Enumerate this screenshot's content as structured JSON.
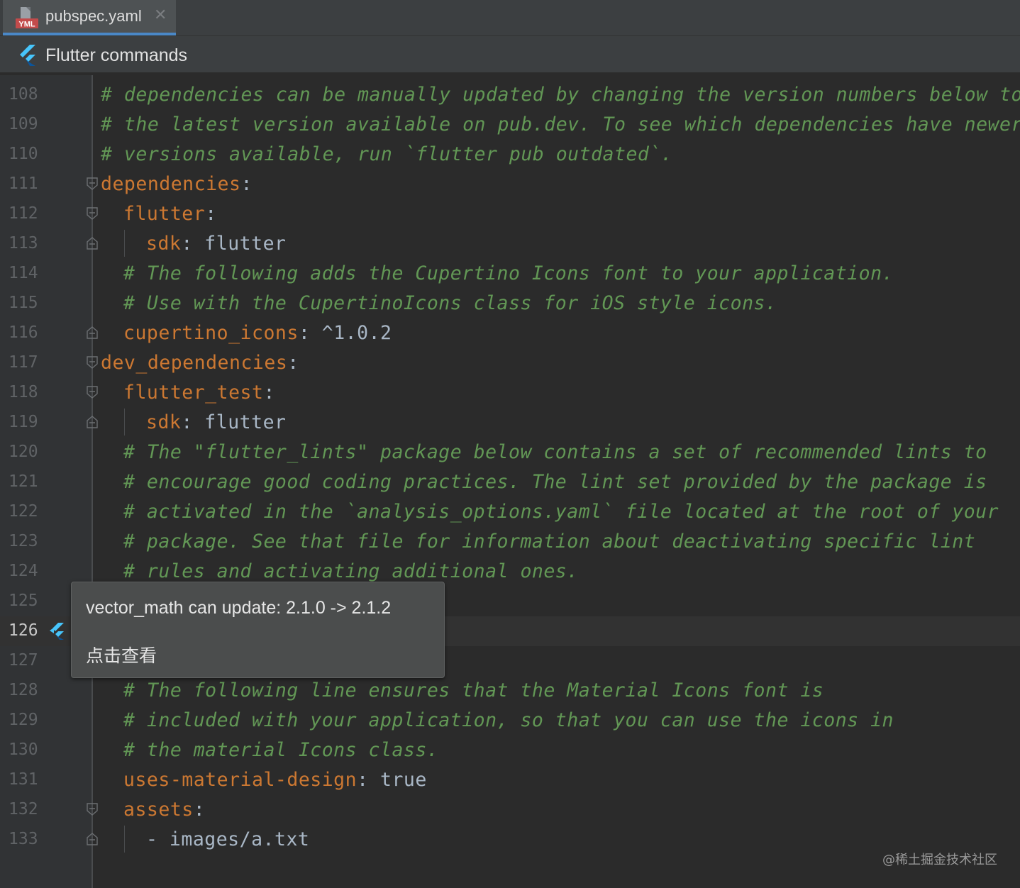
{
  "tab": {
    "icon": "yaml-file-icon",
    "title": "pubspec.yaml",
    "close_glyph": "✕"
  },
  "toolbar": {
    "icon": "flutter-icon",
    "label": "Flutter commands"
  },
  "editor": {
    "active_line": "126",
    "lines": [
      {
        "n": "108",
        "indent": 0,
        "kind": "comment",
        "text": "# dependencies can be manually updated by changing the version numbers below to"
      },
      {
        "n": "109",
        "indent": 0,
        "kind": "comment",
        "text": "# the latest version available on pub.dev. To see which dependencies have newer"
      },
      {
        "n": "110",
        "indent": 0,
        "kind": "comment",
        "text": "# versions available, run `flutter pub outdated`."
      },
      {
        "n": "111",
        "indent": 0,
        "kind": "kv",
        "key": "dependencies",
        "sep": ":",
        "value": "",
        "fold": "open"
      },
      {
        "n": "112",
        "indent": 1,
        "kind": "kv",
        "key": "flutter",
        "sep": ":",
        "value": "",
        "fold": "open"
      },
      {
        "n": "113",
        "indent": 2,
        "kind": "kv",
        "key": "sdk",
        "sep": ": ",
        "value": "flutter",
        "fold": "close"
      },
      {
        "n": "114",
        "indent": 1,
        "kind": "comment",
        "text": "# The following adds the Cupertino Icons font to your application."
      },
      {
        "n": "115",
        "indent": 1,
        "kind": "comment",
        "text": "# Use with the CupertinoIcons class for iOS style icons."
      },
      {
        "n": "116",
        "indent": 1,
        "kind": "kv",
        "key": "cupertino_icons",
        "sep": ": ",
        "value": "^1.0.2",
        "fold": "close"
      },
      {
        "n": "117",
        "indent": 0,
        "kind": "kv",
        "key": "dev_dependencies",
        "sep": ":",
        "value": "",
        "fold": "open"
      },
      {
        "n": "118",
        "indent": 1,
        "kind": "kv",
        "key": "flutter_test",
        "sep": ":",
        "value": "",
        "fold": "open"
      },
      {
        "n": "119",
        "indent": 2,
        "kind": "kv",
        "key": "sdk",
        "sep": ": ",
        "value": "flutter",
        "fold": "close"
      },
      {
        "n": "120",
        "indent": 1,
        "kind": "comment",
        "text": "# The \"flutter_lints\" package below contains a set of recommended lints to"
      },
      {
        "n": "121",
        "indent": 1,
        "kind": "comment",
        "text": "# encourage good coding practices. The lint set provided by the package is"
      },
      {
        "n": "122",
        "indent": 1,
        "kind": "comment",
        "text": "# activated in the `analysis_options.yaml` file located at the root of your"
      },
      {
        "n": "123",
        "indent": 1,
        "kind": "comment",
        "text": "# package. See that file for information about deactivating specific lint"
      },
      {
        "n": "124",
        "indent": 1,
        "kind": "comment",
        "text": "# rules and activating additional ones."
      },
      {
        "n": "125",
        "indent": 0,
        "kind": "blank",
        "text": ""
      },
      {
        "n": "126",
        "indent": 0,
        "kind": "blank",
        "text": ""
      },
      {
        "n": "127",
        "indent": 0,
        "kind": "blank",
        "text": ""
      },
      {
        "n": "128",
        "indent": 1,
        "kind": "comment",
        "text": "# The following line ensures that the Material Icons font is"
      },
      {
        "n": "129",
        "indent": 1,
        "kind": "comment",
        "text": "# included with your application, so that you can use the icons in"
      },
      {
        "n": "130",
        "indent": 1,
        "kind": "comment",
        "text": "# the material Icons class."
      },
      {
        "n": "131",
        "indent": 1,
        "kind": "kv",
        "key": "uses-material-design",
        "sep": ": ",
        "value": "true",
        "fold": ""
      },
      {
        "n": "132",
        "indent": 1,
        "kind": "kv",
        "key": "assets",
        "sep": ":",
        "value": "",
        "fold": "open"
      },
      {
        "n": "133",
        "indent": 2,
        "kind": "list",
        "text": "- images/a.txt",
        "fold": "close"
      }
    ]
  },
  "popup": {
    "message": "vector_math can update: 2.1.0 -> 2.1.2",
    "link": "点击查看",
    "gutter_icon": "flutter-update-icon"
  },
  "watermark": "@稀土掘金技术社区",
  "colors": {
    "keyword": "#cc7832",
    "comment": "#629755",
    "text": "#a9b7c6",
    "background": "#2b2b2b",
    "tab_underline": "#4a88c7"
  }
}
